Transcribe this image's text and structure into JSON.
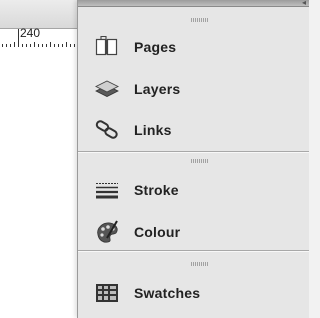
{
  "ruler": {
    "label": "240"
  },
  "panel": {
    "collapse_glyph": "◂",
    "groups": [
      {
        "items": [
          {
            "label": "Pages",
            "icon": "pages-icon"
          },
          {
            "label": "Layers",
            "icon": "layers-icon"
          },
          {
            "label": "Links",
            "icon": "links-icon"
          }
        ]
      },
      {
        "items": [
          {
            "label": "Stroke",
            "icon": "stroke-icon"
          },
          {
            "label": "Colour",
            "icon": "colour-icon"
          }
        ]
      },
      {
        "items": [
          {
            "label": "Swatches",
            "icon": "swatches-icon"
          }
        ]
      }
    ]
  },
  "colors": {
    "panel_bg": "#e6e6e6",
    "label_text": "#222222",
    "divider": "#a8a8a8"
  }
}
